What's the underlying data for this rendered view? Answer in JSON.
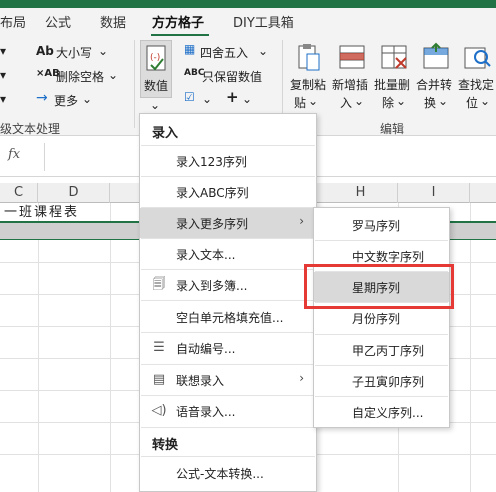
{
  "tabs": [
    {
      "label": "布局"
    },
    {
      "label": "公式"
    },
    {
      "label": "数据"
    },
    {
      "label": "方方格子"
    },
    {
      "label": "DIY工具箱"
    }
  ],
  "ribbon": {
    "left_items": [
      "大小写",
      "删除空格",
      "更多"
    ],
    "left_group_label": "级文本处理",
    "numeric_label": "数值",
    "round_label": "四舍五入",
    "keep_label": "只保留数值",
    "copy_paste_label_1": "复制粘",
    "copy_paste_label_2": "贴",
    "insert_label_1": "新增插",
    "insert_label_2": "入",
    "batch_delete_label_1": "批量删",
    "batch_delete_label_2": "除",
    "merge_label_1": "合并转",
    "merge_label_2": "换",
    "find_label_1": "查找定",
    "find_label_2": "位",
    "edit_group_label": "编辑"
  },
  "formula_bar": {
    "fx": "fx"
  },
  "columns": [
    "C",
    "D",
    "H",
    "I"
  ],
  "sheet": {
    "title_text": "一班课程表"
  },
  "main_menu": {
    "header_input": "录入",
    "items": [
      {
        "label": "录入123序列",
        "icon": ""
      },
      {
        "label": "录入ABC序列",
        "icon": ""
      },
      {
        "label": "录入更多序列",
        "icon": ""
      },
      {
        "label": "录入文本...",
        "icon": ""
      },
      {
        "label": "录入到多簿...",
        "icon": "workbook-icon"
      },
      {
        "label": "空白单元格填充值...",
        "icon": ""
      },
      {
        "label": "自动编号...",
        "icon": "numbering-icon"
      },
      {
        "label": "联想录入",
        "icon": "associate-icon"
      },
      {
        "label": "语音录入...",
        "icon": "speaker-icon"
      }
    ],
    "header_convert": "转换",
    "convert_items": [
      {
        "label": "公式-文本转换..."
      }
    ]
  },
  "sub_menu": {
    "items": [
      {
        "label": "罗马序列"
      },
      {
        "label": "中文数字序列"
      },
      {
        "label": "星期序列"
      },
      {
        "label": "月份序列"
      },
      {
        "label": "甲乙丙丁序列"
      },
      {
        "label": "子丑寅卯序列"
      },
      {
        "label": "自定义序列..."
      }
    ]
  },
  "colors": {
    "accent": "#217346",
    "highlight_box": "#e53935",
    "hover": "#d9d9d9"
  }
}
